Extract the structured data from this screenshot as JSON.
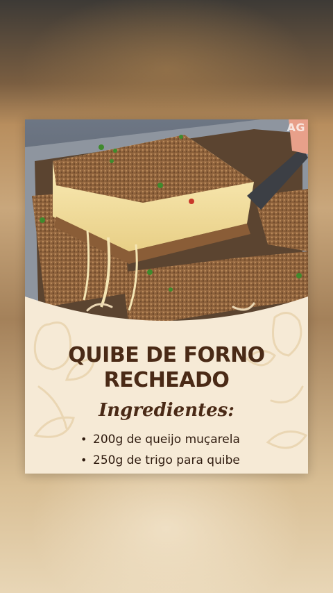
{
  "watermark": "AG",
  "recipe": {
    "title_line1": "QUIBE DE FORNO",
    "title_line2": "RECHEADO",
    "ingredients_heading": "Ingredientes:",
    "ingredients": [
      "200g de queijo muçarela",
      "250g de trigo para quibe"
    ]
  },
  "colors": {
    "card_background": "#f6ead6",
    "title_text": "#4a2a16",
    "doodle_stroke": "#ead6b3"
  },
  "icons": {
    "bullet": "•",
    "photo": "baked-kibbeh-photo",
    "decor": "pear-leaf-doodles"
  }
}
